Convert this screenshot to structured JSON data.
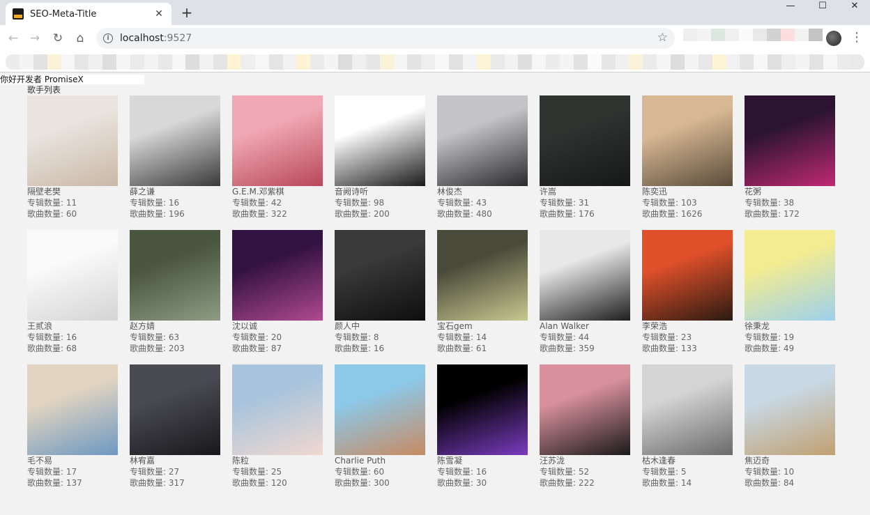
{
  "browser": {
    "tab_title": "SEO-Meta-Title",
    "tab_close": "✕",
    "new_tab": "+",
    "url_host": "localhost",
    "url_port": ":9527",
    "window_minimize": "—",
    "window_maximize": "☐",
    "window_close": "✕"
  },
  "page": {
    "greeting": "你好开发者 PromiseX",
    "list_title": "歌手列表",
    "album_label": "专辑数量: ",
    "song_label": "歌曲数量: "
  },
  "singers": [
    {
      "name": "隔壁老樊",
      "albums": "11",
      "songs": "60",
      "tone": [
        "#e9e4df",
        "#c9b8a6"
      ]
    },
    {
      "name": "薛之谦",
      "albums": "16",
      "songs": "196",
      "tone": [
        "#d8d8d8",
        "#3a3a3a"
      ]
    },
    {
      "name": "G.E.M.邓紫棋",
      "albums": "42",
      "songs": "322",
      "tone": [
        "#f0a8b4",
        "#b8485a"
      ]
    },
    {
      "name": "音阙诗听",
      "albums": "98",
      "songs": "200",
      "tone": [
        "#ffffff",
        "#1a1a1a"
      ]
    },
    {
      "name": "林俊杰",
      "albums": "43",
      "songs": "480",
      "tone": [
        "#c4c4c8",
        "#2a2a2e"
      ]
    },
    {
      "name": "许嵩",
      "albums": "31",
      "songs": "176",
      "tone": [
        "#2f3431",
        "#161816"
      ]
    },
    {
      "name": "陈奕迅",
      "albums": "103",
      "songs": "1626",
      "tone": [
        "#d8b894",
        "#5a4c3a"
      ]
    },
    {
      "name": "花粥",
      "albums": "38",
      "songs": "172",
      "tone": [
        "#2a1430",
        "#c02a74"
      ]
    },
    {
      "name": "王贰浪",
      "albums": "16",
      "songs": "68",
      "tone": [
        "#fafafa",
        "#d4d4d6"
      ]
    },
    {
      "name": "赵方婧",
      "albums": "63",
      "songs": "203",
      "tone": [
        "#4a5640",
        "#8e9c84"
      ]
    },
    {
      "name": "沈以诚",
      "albums": "20",
      "songs": "87",
      "tone": [
        "#321240",
        "#b04a90"
      ]
    },
    {
      "name": "颜人中",
      "albums": "8",
      "songs": "16",
      "tone": [
        "#3a3a3a",
        "#0e0e0e"
      ]
    },
    {
      "name": "宝石gem",
      "albums": "14",
      "songs": "61",
      "tone": [
        "#4a4a3a",
        "#c8c890"
      ]
    },
    {
      "name": "Alan Walker",
      "albums": "44",
      "songs": "359",
      "tone": [
        "#e8e8e8",
        "#1e1e1e"
      ]
    },
    {
      "name": "李荣浩",
      "albums": "23",
      "songs": "133",
      "tone": [
        "#e0502a",
        "#2a1a12"
      ]
    },
    {
      "name": "徐秉龙",
      "albums": "19",
      "songs": "49",
      "tone": [
        "#f4ec90",
        "#9cd0ec"
      ]
    },
    {
      "name": "毛不易",
      "albums": "17",
      "songs": "137",
      "tone": [
        "#e2d4c0",
        "#6c98c0"
      ]
    },
    {
      "name": "林宥嘉",
      "albums": "27",
      "songs": "317",
      "tone": [
        "#4a4a52",
        "#18181c"
      ]
    },
    {
      "name": "陈粒",
      "albums": "25",
      "songs": "120",
      "tone": [
        "#a8c4dc",
        "#f0d8d0"
      ]
    },
    {
      "name": "Charlie Puth",
      "albums": "60",
      "songs": "300",
      "tone": [
        "#8cc8e8",
        "#c88a62"
      ]
    },
    {
      "name": "陈雪凝",
      "albums": "16",
      "songs": "30",
      "tone": [
        "#000000",
        "#7a3cc0"
      ]
    },
    {
      "name": "汪苏泷",
      "albums": "52",
      "songs": "222",
      "tone": [
        "#d8909c",
        "#1a1a1a"
      ]
    },
    {
      "name": "枯木逢春",
      "albums": "5",
      "songs": "14",
      "tone": [
        "#d4d4d4",
        "#6a6a6a"
      ]
    },
    {
      "name": "焦迈奇",
      "albums": "10",
      "songs": "84",
      "tone": [
        "#c8d8e4",
        "#c0a070"
      ]
    }
  ]
}
